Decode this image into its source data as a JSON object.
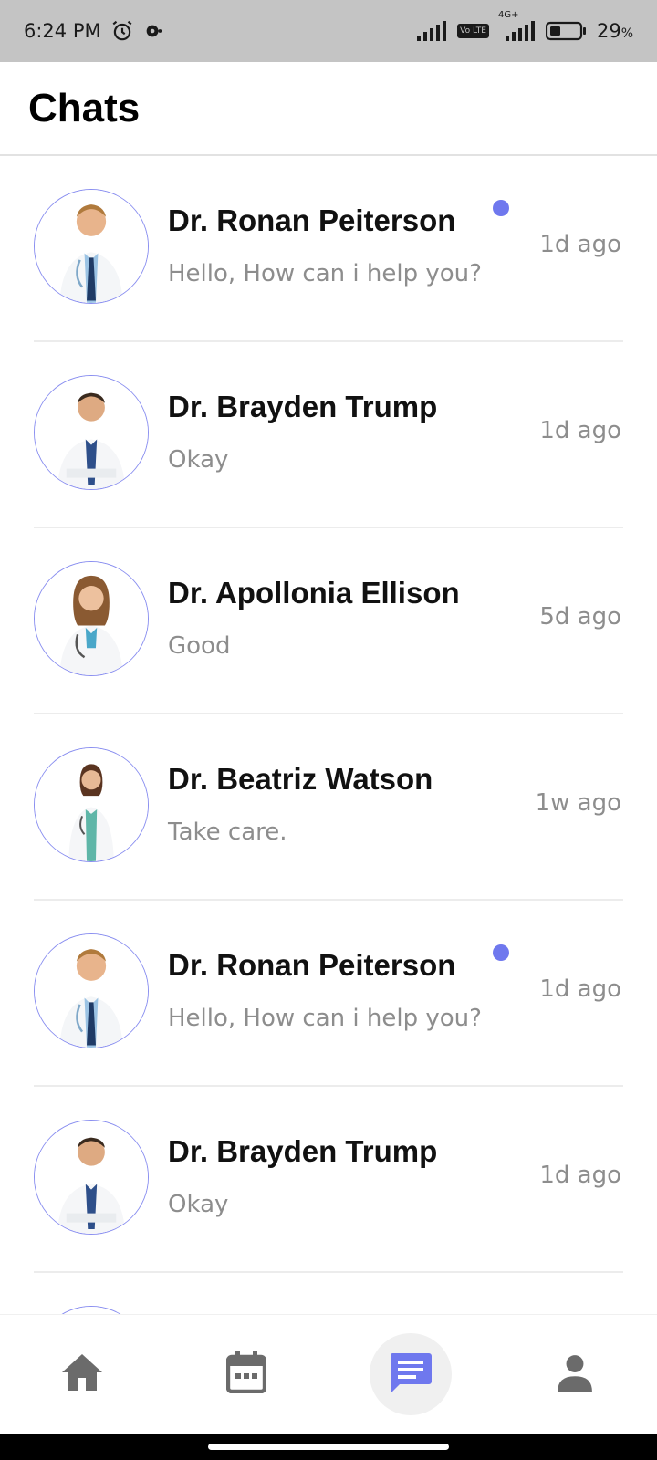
{
  "status_bar": {
    "time": "6:24 PM",
    "battery": "29",
    "battery_unit": "%",
    "network_label": "4G+",
    "volte_label": "Vo LTE"
  },
  "header": {
    "title": "Chats"
  },
  "colors": {
    "accent": "#6f78ee",
    "muted_text": "#8d8d8d"
  },
  "chats": [
    {
      "name": "Dr. Ronan Peiterson",
      "message": "Hello, How can i help you?",
      "time": "1d ago",
      "unread": true
    },
    {
      "name": "Dr. Brayden Trump",
      "message": "Okay",
      "time": "1d ago",
      "unread": false
    },
    {
      "name": "Dr. Apollonia Ellison",
      "message": "Good",
      "time": "5d ago",
      "unread": false
    },
    {
      "name": "Dr. Beatriz Watson",
      "message": "Take care.",
      "time": "1w ago",
      "unread": false
    },
    {
      "name": "Dr. Ronan Peiterson",
      "message": "Hello, How can i help you?",
      "time": "1d ago",
      "unread": true
    },
    {
      "name": "Dr. Brayden Trump",
      "message": "Okay",
      "time": "1d ago",
      "unread": false
    },
    {
      "name": "",
      "message": "",
      "time": "",
      "unread": false
    }
  ],
  "bottom_nav": [
    {
      "icon": "home-icon",
      "active": false
    },
    {
      "icon": "calendar-icon",
      "active": false
    },
    {
      "icon": "chat-icon",
      "active": true
    },
    {
      "icon": "profile-icon",
      "active": false
    }
  ]
}
